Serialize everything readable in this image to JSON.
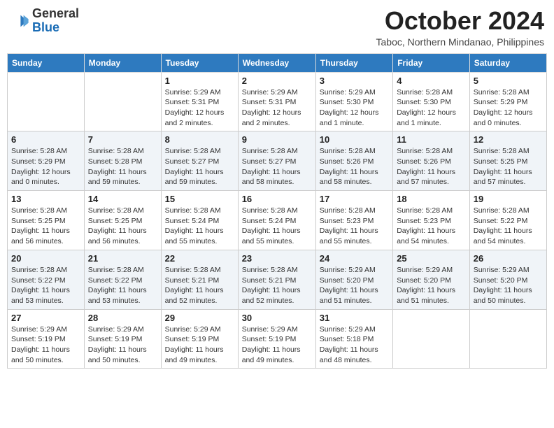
{
  "header": {
    "logo": {
      "general": "General",
      "blue": "Blue"
    },
    "title": "October 2024",
    "location": "Taboc, Northern Mindanao, Philippines"
  },
  "days_of_week": [
    "Sunday",
    "Monday",
    "Tuesday",
    "Wednesday",
    "Thursday",
    "Friday",
    "Saturday"
  ],
  "weeks": [
    [
      null,
      null,
      {
        "day": 1,
        "sunrise": "5:29 AM",
        "sunset": "5:31 PM",
        "daylight": "12 hours and 2 minutes."
      },
      {
        "day": 2,
        "sunrise": "5:29 AM",
        "sunset": "5:31 PM",
        "daylight": "12 hours and 2 minutes."
      },
      {
        "day": 3,
        "sunrise": "5:29 AM",
        "sunset": "5:30 PM",
        "daylight": "12 hours and 1 minute."
      },
      {
        "day": 4,
        "sunrise": "5:28 AM",
        "sunset": "5:30 PM",
        "daylight": "12 hours and 1 minute."
      },
      {
        "day": 5,
        "sunrise": "5:28 AM",
        "sunset": "5:29 PM",
        "daylight": "12 hours and 0 minutes."
      }
    ],
    [
      {
        "day": 6,
        "sunrise": "5:28 AM",
        "sunset": "5:29 PM",
        "daylight": "12 hours and 0 minutes."
      },
      {
        "day": 7,
        "sunrise": "5:28 AM",
        "sunset": "5:28 PM",
        "daylight": "11 hours and 59 minutes."
      },
      {
        "day": 8,
        "sunrise": "5:28 AM",
        "sunset": "5:27 PM",
        "daylight": "11 hours and 59 minutes."
      },
      {
        "day": 9,
        "sunrise": "5:28 AM",
        "sunset": "5:27 PM",
        "daylight": "11 hours and 58 minutes."
      },
      {
        "day": 10,
        "sunrise": "5:28 AM",
        "sunset": "5:26 PM",
        "daylight": "11 hours and 58 minutes."
      },
      {
        "day": 11,
        "sunrise": "5:28 AM",
        "sunset": "5:26 PM",
        "daylight": "11 hours and 57 minutes."
      },
      {
        "day": 12,
        "sunrise": "5:28 AM",
        "sunset": "5:25 PM",
        "daylight": "11 hours and 57 minutes."
      }
    ],
    [
      {
        "day": 13,
        "sunrise": "5:28 AM",
        "sunset": "5:25 PM",
        "daylight": "11 hours and 56 minutes."
      },
      {
        "day": 14,
        "sunrise": "5:28 AM",
        "sunset": "5:25 PM",
        "daylight": "11 hours and 56 minutes."
      },
      {
        "day": 15,
        "sunrise": "5:28 AM",
        "sunset": "5:24 PM",
        "daylight": "11 hours and 55 minutes."
      },
      {
        "day": 16,
        "sunrise": "5:28 AM",
        "sunset": "5:24 PM",
        "daylight": "11 hours and 55 minutes."
      },
      {
        "day": 17,
        "sunrise": "5:28 AM",
        "sunset": "5:23 PM",
        "daylight": "11 hours and 55 minutes."
      },
      {
        "day": 18,
        "sunrise": "5:28 AM",
        "sunset": "5:23 PM",
        "daylight": "11 hours and 54 minutes."
      },
      {
        "day": 19,
        "sunrise": "5:28 AM",
        "sunset": "5:22 PM",
        "daylight": "11 hours and 54 minutes."
      }
    ],
    [
      {
        "day": 20,
        "sunrise": "5:28 AM",
        "sunset": "5:22 PM",
        "daylight": "11 hours and 53 minutes."
      },
      {
        "day": 21,
        "sunrise": "5:28 AM",
        "sunset": "5:22 PM",
        "daylight": "11 hours and 53 minutes."
      },
      {
        "day": 22,
        "sunrise": "5:28 AM",
        "sunset": "5:21 PM",
        "daylight": "11 hours and 52 minutes."
      },
      {
        "day": 23,
        "sunrise": "5:28 AM",
        "sunset": "5:21 PM",
        "daylight": "11 hours and 52 minutes."
      },
      {
        "day": 24,
        "sunrise": "5:29 AM",
        "sunset": "5:20 PM",
        "daylight": "11 hours and 51 minutes."
      },
      {
        "day": 25,
        "sunrise": "5:29 AM",
        "sunset": "5:20 PM",
        "daylight": "11 hours and 51 minutes."
      },
      {
        "day": 26,
        "sunrise": "5:29 AM",
        "sunset": "5:20 PM",
        "daylight": "11 hours and 50 minutes."
      }
    ],
    [
      {
        "day": 27,
        "sunrise": "5:29 AM",
        "sunset": "5:19 PM",
        "daylight": "11 hours and 50 minutes."
      },
      {
        "day": 28,
        "sunrise": "5:29 AM",
        "sunset": "5:19 PM",
        "daylight": "11 hours and 50 minutes."
      },
      {
        "day": 29,
        "sunrise": "5:29 AM",
        "sunset": "5:19 PM",
        "daylight": "11 hours and 49 minutes."
      },
      {
        "day": 30,
        "sunrise": "5:29 AM",
        "sunset": "5:19 PM",
        "daylight": "11 hours and 49 minutes."
      },
      {
        "day": 31,
        "sunrise": "5:29 AM",
        "sunset": "5:18 PM",
        "daylight": "11 hours and 48 minutes."
      },
      null,
      null
    ]
  ]
}
